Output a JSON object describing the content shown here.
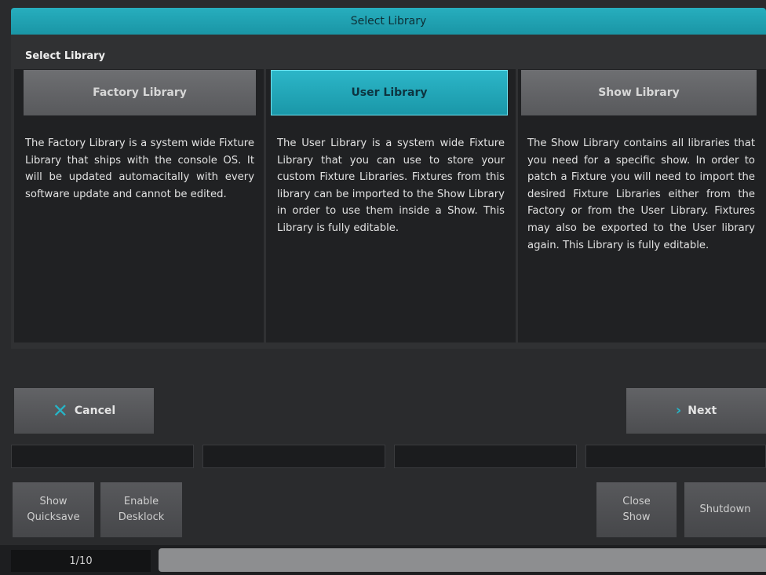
{
  "window": {
    "title": "Select Library"
  },
  "dialog": {
    "group_label": "Select Library",
    "libraries": [
      {
        "label": "Factory Library",
        "description": "The Factory Library is a system wide Fixture Library that ships with the console OS. It will be updated automacitally with every software update and cannot be edited.",
        "selected": false
      },
      {
        "label": "User Library",
        "description": "The User Library is a system wide Fixture Library that you can use to store your custom Fixture Libraries. Fixtures from this library can be imported to the Show Library in order to use them inside a Show. This Library is fully editable.",
        "selected": true
      },
      {
        "label": "Show Library",
        "description": "The Show Library contains all libraries that you need for a specific show. In order to patch a Fixture you will need to import the desired Fixture Libraries either from the Factory or from the User Library. Fixtures may also be exported to the User library again. This Library is fully editable.",
        "selected": false
      }
    ]
  },
  "actions": {
    "cancel_label": "Cancel",
    "next_label": "Next",
    "cancel_icon": "close-x-icon",
    "next_icon": "chevron-right-icon"
  },
  "system_buttons": {
    "quicksave_line1": "Show",
    "quicksave_line2": "Quicksave",
    "desklock_line1": "Enable",
    "desklock_line2": "Desklock",
    "close_line1": "Close",
    "close_line2": "Show",
    "shutdown": "Shutdown"
  },
  "status": {
    "page": "1/10"
  },
  "colors": {
    "accent": "#1fa8b8",
    "background": "#2a2b2d",
    "panel": "#202123"
  }
}
